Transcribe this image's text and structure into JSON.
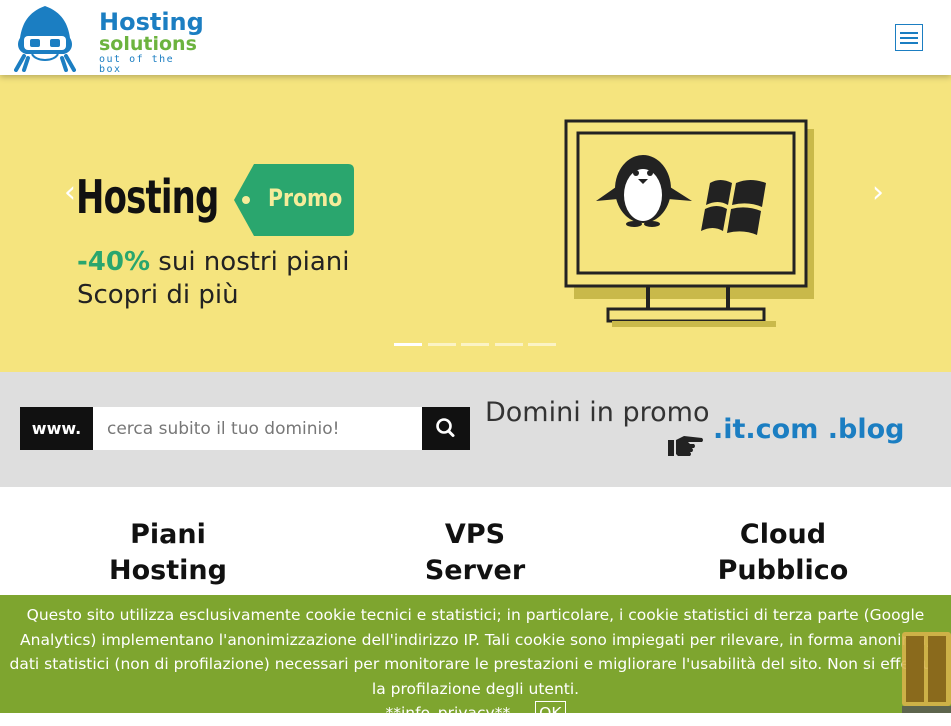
{
  "header": {
    "logo": {
      "line1": "Hosting",
      "line2": "solutions",
      "line3": "out of the box"
    },
    "menu_icon": "hamburger-icon"
  },
  "banner": {
    "title": "Hosting",
    "tag": "Promo",
    "discount": "-40%",
    "line1_rest": " sui nostri piani",
    "line2": "Scopri di più",
    "prev_arrow": "‹",
    "next_arrow": "›",
    "slides_count": 5,
    "active_slide": 1,
    "colors": {
      "background": "#f5e47e",
      "tag": "#2aa66e",
      "discount": "#2aa66e"
    }
  },
  "domain_search": {
    "prefix": "www.",
    "placeholder": "cerca subito il tuo dominio!",
    "button_icon": "search-icon",
    "promo_heading": "Domini in promo",
    "promo_tlds": ".it.com .blog"
  },
  "products": [
    {
      "line1": "Piani",
      "line2": "Hosting"
    },
    {
      "line1": "VPS",
      "line2": "Server"
    },
    {
      "line1": "Cloud",
      "line2": "Pubblico"
    }
  ],
  "cookie_bar": {
    "text": "Questo sito utilizza esclusivamente cookie tecnici e statistici; in particolare, i cookie statistici di terza parte (Google Analytics) implementano l'anonimizzazione dell'indirizzo IP. Tali cookie sono impiegati per rilevare, in forma anonima, dati statistici (non di profilazione) necessari per monitorare le prestazioni e migliorare l'usabilità del sito. Non si effettua la profilazione degli utenti.",
    "link": "**info_privacy**",
    "ok": "OK",
    "color": "#7ea52f"
  },
  "colors": {
    "brand_blue": "#1b7ec2",
    "brand_green": "#6cb33e"
  }
}
